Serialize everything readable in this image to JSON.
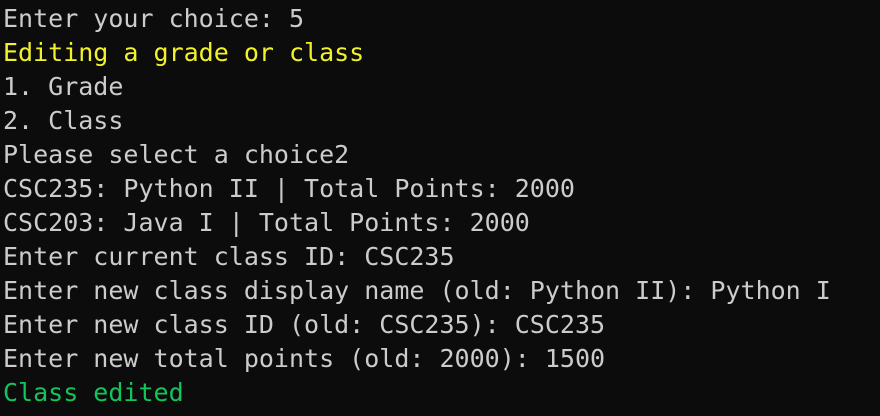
{
  "colors": {
    "background": "#0c0c0c",
    "text": "#cccccc",
    "heading": "#f2f22a",
    "success": "#13c35b"
  },
  "terminal": {
    "lines": [
      "Enter your choice: 5",
      "Editing a grade or class",
      "1. Grade",
      "2. Class",
      "Please select a choice2",
      "CSC235: Python II | Total Points: 2000",
      "CSC203: Java I | Total Points: 2000",
      "Enter current class ID: CSC235",
      "Enter new class display name (old: Python II): Python I",
      "Enter new class ID (old: CSC235): CSC235",
      "Enter new total points (old: 2000): 1500",
      "Class edited"
    ]
  }
}
